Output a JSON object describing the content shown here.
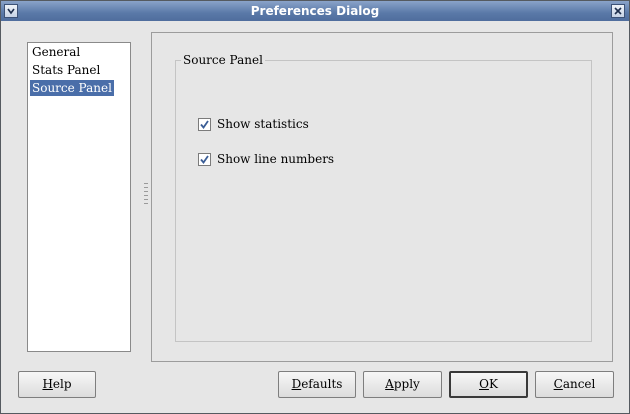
{
  "window": {
    "title": "Preferences Dialog"
  },
  "titlebar": {
    "menu_icon": "chevron-down-icon",
    "close_icon": "close-icon"
  },
  "sidebar": {
    "items": [
      {
        "label": "General",
        "selected": false
      },
      {
        "label": "Stats Panel",
        "selected": false
      },
      {
        "label": "Source Panel",
        "selected": true
      }
    ]
  },
  "panel": {
    "group_title": "Source Panel",
    "options": [
      {
        "label": "Show statistics",
        "checked": true
      },
      {
        "label": "Show line numbers",
        "checked": true
      }
    ]
  },
  "buttons": {
    "help": {
      "mnemonic": "H",
      "rest": "elp"
    },
    "defaults": {
      "mnemonic": "D",
      "rest": "efaults"
    },
    "apply": {
      "mnemonic": "A",
      "rest": "pply"
    },
    "ok": {
      "mnemonic": "O",
      "rest": "K"
    },
    "cancel": {
      "mnemonic": "C",
      "rest": "ancel"
    }
  },
  "colors": {
    "title_bar": "#5a79a8",
    "selection": "#4a6ea9",
    "background": "#e6e6e6"
  }
}
